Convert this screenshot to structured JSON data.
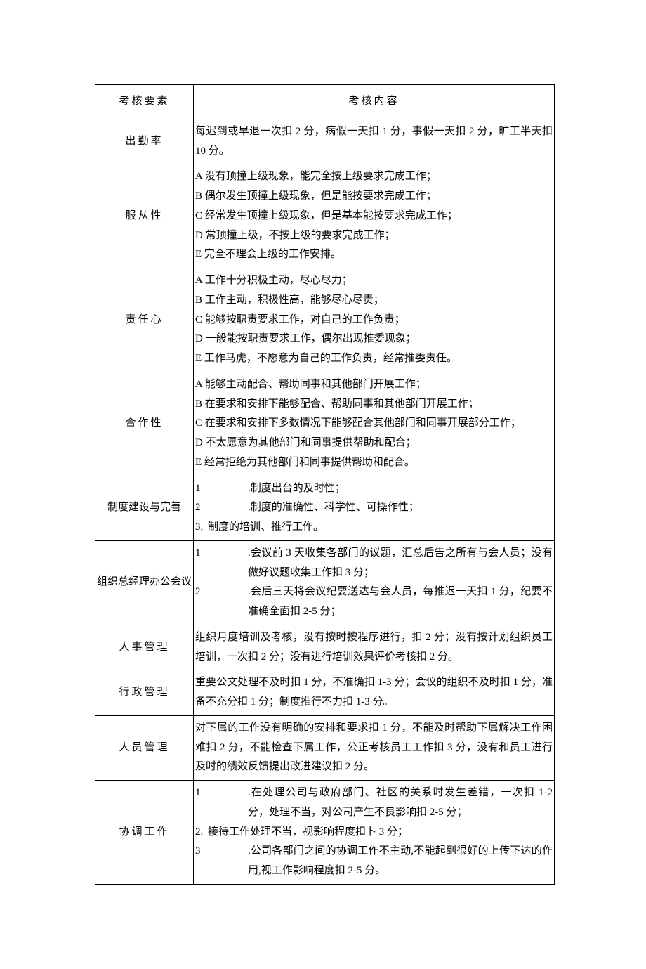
{
  "header": {
    "col1": "考核要素",
    "col2": "考核内容"
  },
  "rows": [
    {
      "label": "出勤率",
      "content": {
        "lines": [
          "每迟到或早退一次扣 2 分，病假一天扣 1 分，事假一天扣 2 分，旷工半天扣10 分。"
        ]
      }
    },
    {
      "label": "服从性",
      "content": {
        "lines": [
          "A 没有顶撞上级现象，能完全按上级要求完成工作；",
          "B 偶尔发生顶撞上级现象，但是能按要求完成工作；",
          "C 经常发生顶撞上级现象，但是基本能按要求完成工作；",
          "D 常顶撞上级，不按上级的要求完成工作；",
          "E 完全不理会上级的工作安排。"
        ]
      }
    },
    {
      "label": "责任心",
      "content": {
        "lines": [
          "A 工作十分积极主动，尽心尽力；",
          "B 工作主动，积极性高，能够尽心尽责；",
          "C 能够按职责要求工作，对自己的工作负责；",
          "D 一般能按职责要求工作，偶尔出现推委现象；",
          "E 工作马虎，不愿意为自己的工作负责，经常推委责任。"
        ]
      }
    },
    {
      "label": "合作性",
      "content": {
        "prelines": [
          ""
        ],
        "lines": [
          "A 能够主动配合、帮助同事和其他部门开展工作；",
          "B 在要求和安排下能够配合、帮助同事和其他部门开展工作；",
          "C 在要求和安排下多数情况下能够配合其他部门和同事开展部分工作；",
          "D 不太愿意为其他部门和同事提供帮助和配合；",
          "E 经常拒绝为其他部门和同事提供帮助和配合。"
        ]
      }
    },
    {
      "label": "制度建设与完善",
      "content": {
        "list": [
          {
            "num": "1",
            "text": ".制度出台的及时性；"
          },
          {
            "num": "2",
            "text": ".制度的准确性、科学性、可操作性；"
          }
        ],
        "tight": [
          {
            "num": "3,",
            "text": "制度的培训、推行工作。"
          }
        ]
      }
    },
    {
      "label": "组织总经理办公会议",
      "content": {
        "list": [
          {
            "num": "1",
            "text": ".会议前 3 天收集各部门的议题，汇总后告之所有与会人员；没有做好议题收集工作扣 3 分；"
          },
          {
            "num": "2",
            "text": ".会后三天将会议纪要送达与会人员，每推迟一天扣 1 分，纪要不准确全面扣 2-5 分；"
          }
        ]
      }
    },
    {
      "label": "人事管理",
      "content": {
        "lines": [
          "组织月度培训及考核，没有按时按程序进行，扣 2 分；没有按计划组织员工培训，一次扣 2 分；没有进行培训效果评价考核扣 2 分。"
        ]
      }
    },
    {
      "label": "行政管理",
      "content": {
        "lines": [
          "重要公文处理不及时扣 1 分，不准确扣 1-3 分；会议的组织不及时扣 1 分，准备不充分扣 1 分；制度推行不力扣 1-3 分。"
        ]
      }
    },
    {
      "label": "人员管理",
      "content": {
        "lines": [
          "对下属的工作没有明确的安排和要求扣 1 分，不能及时帮助下属解决工作困难扣 2 分，不能检查下属工作，公正考核员工工作扣 3 分，没有和员工进行及时的绩效反馈提出改进建议扣 2 分。"
        ]
      }
    },
    {
      "label": "协调工作",
      "content": {
        "list": [
          {
            "num": "1",
            "text": ".在处理公司与政府部门、社区的关系时发生差错，一次扣 1-2 分，处理不当，对公司产生不良影响扣 2-5 分；"
          }
        ],
        "tight": [
          {
            "num": "2.",
            "text": "接待工作处理不当，视影响程度扣卜 3 分；"
          }
        ],
        "list2": [
          {
            "num": "3",
            "text": ".公司各部门之间的协调工作不主动,不能起到很好的上传下达的作用,视工作影响程度扣 2-5 分。"
          }
        ]
      }
    }
  ]
}
